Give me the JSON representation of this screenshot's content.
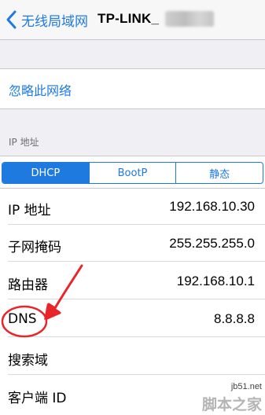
{
  "navbar": {
    "back_label": "无线局域网",
    "title": "TP-LINK_"
  },
  "forget_network": {
    "label": "忽略此网络"
  },
  "ip_section": {
    "header": "IP 地址"
  },
  "mode_tabs": [
    {
      "label": "DHCP",
      "selected": true
    },
    {
      "label": "BootP",
      "selected": false
    },
    {
      "label": "静态",
      "selected": false
    }
  ],
  "rows": [
    {
      "label": "IP 地址",
      "value": "192.168.10.30"
    },
    {
      "label": "子网掩码",
      "value": "255.255.255.0"
    },
    {
      "label": "路由器",
      "value": "192.168.10.1"
    },
    {
      "label": "DNS",
      "value": "8.8.8.8"
    },
    {
      "label": "搜索域",
      "value": ""
    },
    {
      "label": "客户端 ID",
      "value": ""
    }
  ],
  "watermark": {
    "line1": "jb51.net",
    "line2": "脚本之家"
  },
  "colors": {
    "accent": "#1f7ae0",
    "annotation": "#e8262a",
    "background": "#efeff4"
  },
  "icons": {
    "back": "chevron-left-icon"
  }
}
